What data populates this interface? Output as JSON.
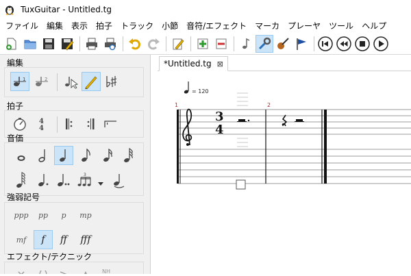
{
  "window": {
    "title": "TuxGuitar - Untitled.tg"
  },
  "menu": [
    "ファイル",
    "編集",
    "表示",
    "拍子",
    "トラック",
    "小節",
    "音符/エフェクト",
    "マーカ",
    "プレーヤ",
    "ツール",
    "ヘルプ"
  ],
  "toolbar": {
    "icons": [
      "new-file-icon",
      "open-file-icon",
      "save-icon",
      "save-as-icon",
      "print-icon",
      "print-preview-icon",
      "undo-icon",
      "redo-icon",
      "edit-song-icon",
      "add-track-icon",
      "remove-track-icon",
      "score-view-icon",
      "tools-icon",
      "guitar-icon",
      "flag-icon",
      "first-icon",
      "previous-icon",
      "stop-icon",
      "play-icon"
    ]
  },
  "panel": {
    "edit_title": "編集",
    "time_title": "拍子",
    "duration_title": "音価",
    "dynamics_title": "強弱記号",
    "effects_title": "エフェクト/テクニック",
    "dynamics_row1": [
      "ppp",
      "pp",
      "p",
      "mp"
    ],
    "dynamics_row2": [
      "mf",
      "f",
      "ff",
      "fff"
    ],
    "time_signature_icon": {
      "top": "4",
      "bottom": "4"
    }
  },
  "document_tab": {
    "label": "*Untitled.tg",
    "close": "⊠"
  },
  "score": {
    "tempo": "= 120",
    "measure1": "1",
    "measure2": "2",
    "time_signature": {
      "top": "3",
      "bottom": "4"
    }
  },
  "colors": {
    "active_bg": "#cce4f7",
    "active_border": "#99c9ef",
    "measure_number": "#b22222"
  }
}
